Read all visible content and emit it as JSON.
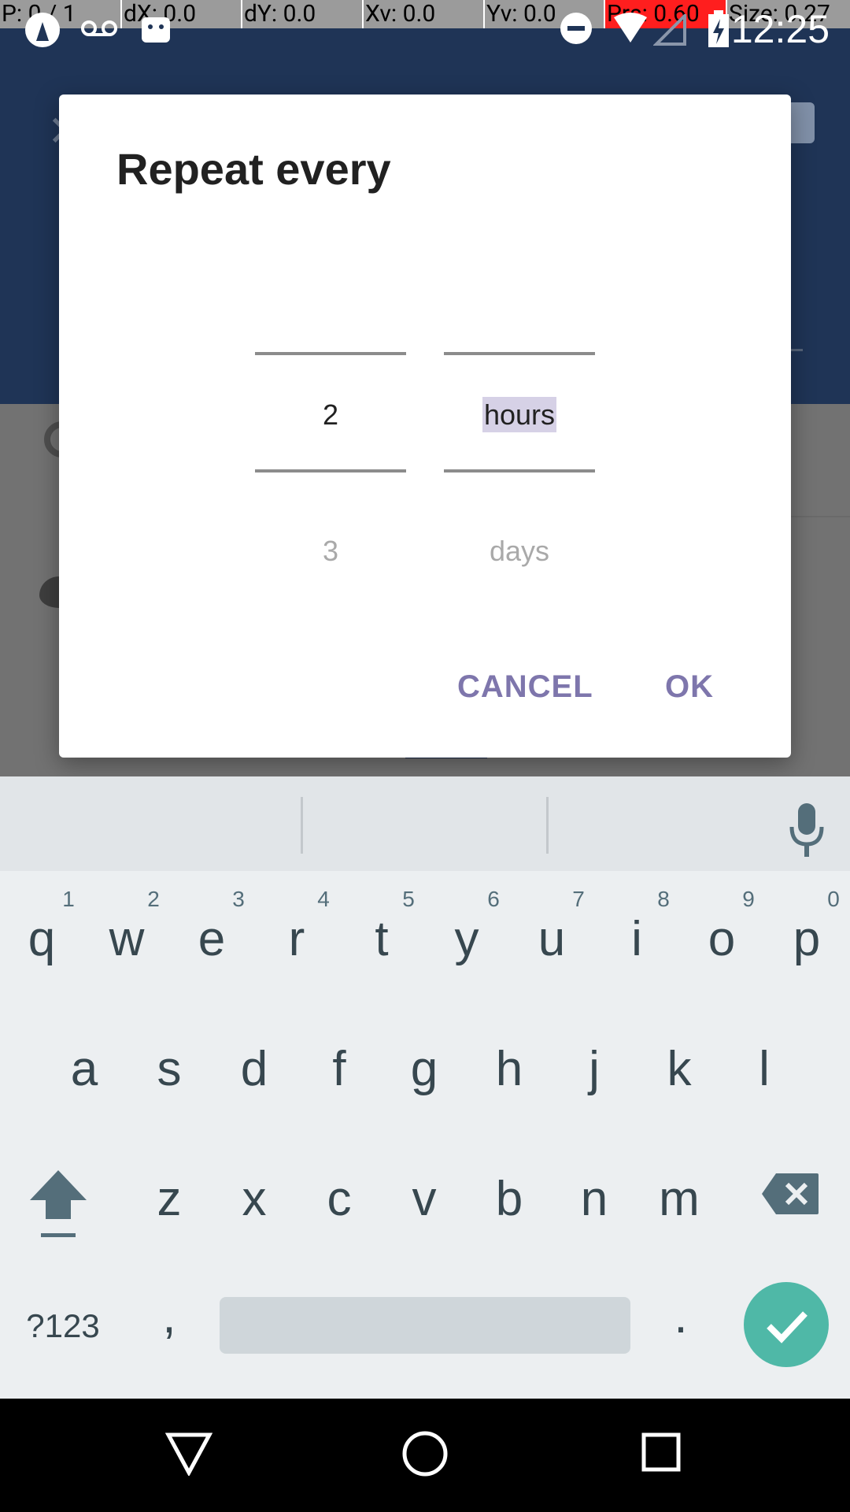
{
  "status_bar": {
    "debug": [
      "P: 0 / 1",
      "dX: 0.0",
      "dY: 0.0",
      "Xv: 0.0",
      "Yv: 0.0",
      "Prs: 0.60",
      "Size: 0.27"
    ],
    "time": "12:25"
  },
  "dialog": {
    "title": "Repeat every",
    "number_picker": {
      "selected": "2",
      "next": "3"
    },
    "unit_picker": {
      "selected": "hours",
      "next": "days"
    },
    "cancel_label": "CANCEL",
    "ok_label": "OK"
  },
  "keyboard": {
    "row1": [
      "q",
      "w",
      "e",
      "r",
      "t",
      "y",
      "u",
      "i",
      "o",
      "p"
    ],
    "row1_hints": [
      "1",
      "2",
      "3",
      "4",
      "5",
      "6",
      "7",
      "8",
      "9",
      "0"
    ],
    "row2": [
      "a",
      "s",
      "d",
      "f",
      "g",
      "h",
      "j",
      "k",
      "l"
    ],
    "row3": [
      "z",
      "x",
      "c",
      "v",
      "b",
      "n",
      "m"
    ],
    "symbols_label": "?123",
    "comma_label": ",",
    "period_label": ".",
    "accent_color": "#4fb8a7"
  },
  "nav_bar": {
    "back_icon": "triangle-back-icon",
    "home_icon": "circle-home-icon",
    "recents_icon": "square-recents-icon"
  }
}
